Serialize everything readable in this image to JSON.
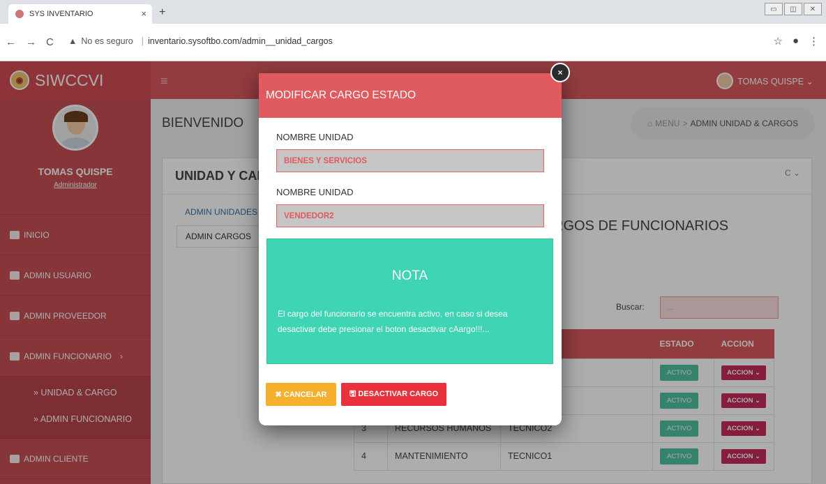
{
  "browser": {
    "tab_title": "SYS INVENTARIO",
    "not_secure": "No es seguro",
    "url": "inventario.sysoftbo.com/admin__unidad_cargos"
  },
  "app": {
    "brand": "SIWCCVI",
    "user_top": "TOMAS QUISPE ⌄"
  },
  "sidebar": {
    "user_name": "TOMAS QUISPE",
    "user_role": "Administrador",
    "items": [
      {
        "label": "INICIO"
      },
      {
        "label": "ADMIN USUARIO"
      },
      {
        "label": "ADMIN PROVEEDOR"
      },
      {
        "label": "ADMIN FUNCIONARIO"
      }
    ],
    "sub_items": [
      {
        "label": "» UNIDAD & CARGO"
      },
      {
        "label": "» ADMIN FUNCIONARIO"
      }
    ],
    "last_item": "ADMIN CLIENTE"
  },
  "main": {
    "welcome": "BIENVENIDO",
    "breadcrumb_menu": "MENU",
    "breadcrumb_sep": ">",
    "breadcrumb_page": "ADMIN UNIDAD & CARGOS",
    "panel_title": "UNIDAD Y CAR",
    "panel_tools": "C ⌄",
    "tab_admin": "ADMIN UNIDADES",
    "tab_cargos": "ADMIN CARGOS",
    "section_title": "RGOS DE FUNCIONARIOS",
    "search_label": "Buscar:",
    "search_placeholder": "...",
    "table": {
      "headers": [
        "",
        "",
        "O",
        "ESTADO",
        "ACCION"
      ],
      "rows": [
        {
          "n": "",
          "unidad": "",
          "cargo": "",
          "estado": "ACTIVO",
          "accion": "ACCION ⌄"
        },
        {
          "n": "",
          "unidad": "",
          "cargo": "",
          "estado": "ACTIVO",
          "accion": "ACCION ⌄"
        },
        {
          "n": "3",
          "unidad": "RECURSOS HUMANOS",
          "cargo": "TECNICO2",
          "estado": "ACTIVO",
          "accion": "ACCION ⌄"
        },
        {
          "n": "4",
          "unidad": "MANTENIMIENTO",
          "cargo": "TECNICO1",
          "estado": "ACTIVO",
          "accion": "ACCION ⌄"
        }
      ]
    }
  },
  "modal": {
    "title": "MODIFICAR CARGO ESTADO",
    "close": "×",
    "label1": "NOMBRE UNIDAD",
    "value1": "BIENES Y SERVICIOS",
    "label2": "NOMBRE UNIDAD",
    "value2": "VENDEDOR2",
    "nota_title": "NOTA",
    "nota_text": "El cargo del funcionario se encuentra activo, en caso si desea desactivar debe presionar el boton desactivar cAargo!!!...",
    "cancel": "✖ CANCELAR",
    "deactivate": "🖫 DESACTIVAR CARGO"
  }
}
